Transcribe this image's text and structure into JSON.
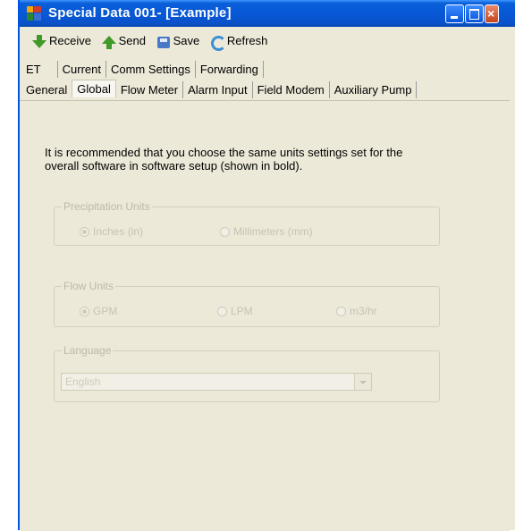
{
  "window": {
    "title": "Special Data 001- [Example]"
  },
  "toolbar": {
    "items": [
      {
        "label": "Receive",
        "icon": "receive-arrow-icon"
      },
      {
        "label": "Send",
        "icon": "send-arrow-icon"
      },
      {
        "label": "Save",
        "icon": "save-disk-icon"
      },
      {
        "label": "Refresh",
        "icon": "refresh-icon"
      }
    ]
  },
  "tabs": {
    "row1": [
      "ET",
      "Current",
      "Comm Settings",
      "Forwarding"
    ],
    "row2": [
      "General",
      "Global",
      "Flow Meter",
      "Alarm Input",
      "Field Modem",
      "Auxiliary Pump"
    ],
    "active": "Global"
  },
  "panel": {
    "note": "It is recommended that you choose the same units settings set for the overall software in software setup (shown in bold).",
    "precipitation": {
      "legend": "Precipitation Units",
      "options": [
        "Inches (in)",
        "Millimeters (mm)"
      ],
      "selected": "Inches (in)"
    },
    "flow": {
      "legend": "Flow Units",
      "options": [
        "GPM",
        "LPM",
        "m3/hr"
      ],
      "selected": "GPM"
    },
    "language": {
      "legend": "Language",
      "value": "English"
    }
  },
  "colors": {
    "title_bar": "#0758d6",
    "panel": "#ece9d8",
    "disabled_text": "#c7c3b3"
  }
}
